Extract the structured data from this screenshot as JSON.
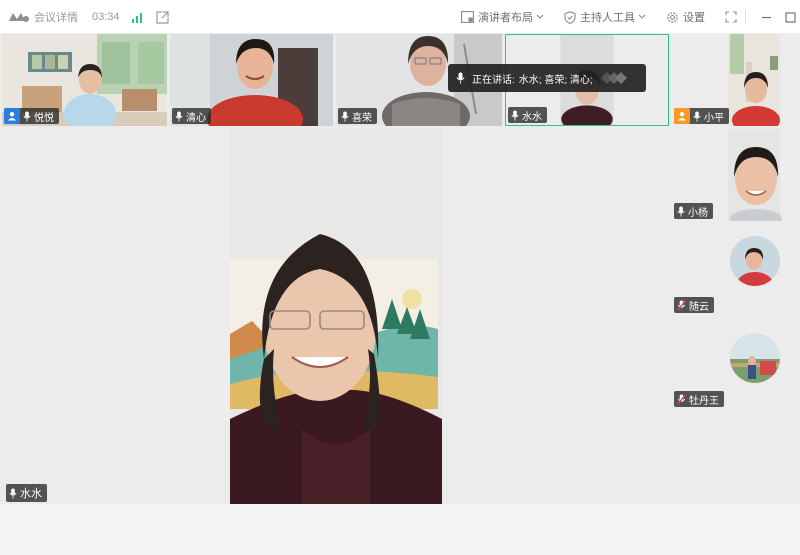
{
  "titlebar": {
    "meeting_info": "会议详情",
    "elapsed": "03:34",
    "presenter_layout": "演讲者布局",
    "host_tools": "主持人工具",
    "settings": "设置"
  },
  "speaking_popup": {
    "label": "正在讲话:",
    "names": "水水; 喜荣; 清心;"
  },
  "top_row": [
    {
      "name": "悦悦",
      "host": true,
      "host_color": "#2a7de1"
    },
    {
      "name": "清心"
    },
    {
      "name": "喜荣"
    },
    {
      "name": "水水"
    },
    {
      "name": "小平",
      "host": true,
      "host_color": "#f59a23"
    }
  ],
  "main_speaker": {
    "name": "水水"
  },
  "side_column": [
    {
      "name": "小杨",
      "muted": false
    },
    {
      "name": "随云",
      "muted": true
    },
    {
      "name": "牡丹王",
      "muted": true
    }
  ],
  "colors": {
    "active_border": "#2dc47c",
    "muted_mic": "#e5484d"
  }
}
